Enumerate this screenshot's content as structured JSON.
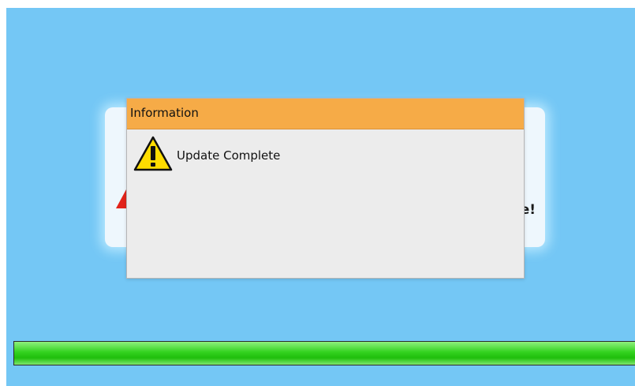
{
  "background_panel": {
    "partial_text": "e!"
  },
  "dialog": {
    "title": "Information",
    "message": "Update Complete",
    "icon": "warning-icon"
  },
  "progress": {
    "fraction": 1.0
  },
  "colors": {
    "screen_background": "#74c7f5",
    "dialog_titlebar": "#f6ab47",
    "dialog_body": "#ececec",
    "progress_fill": "#2fcf1b",
    "warning_yellow": "#ffdd00",
    "back_warning_red": "#e2231a"
  }
}
